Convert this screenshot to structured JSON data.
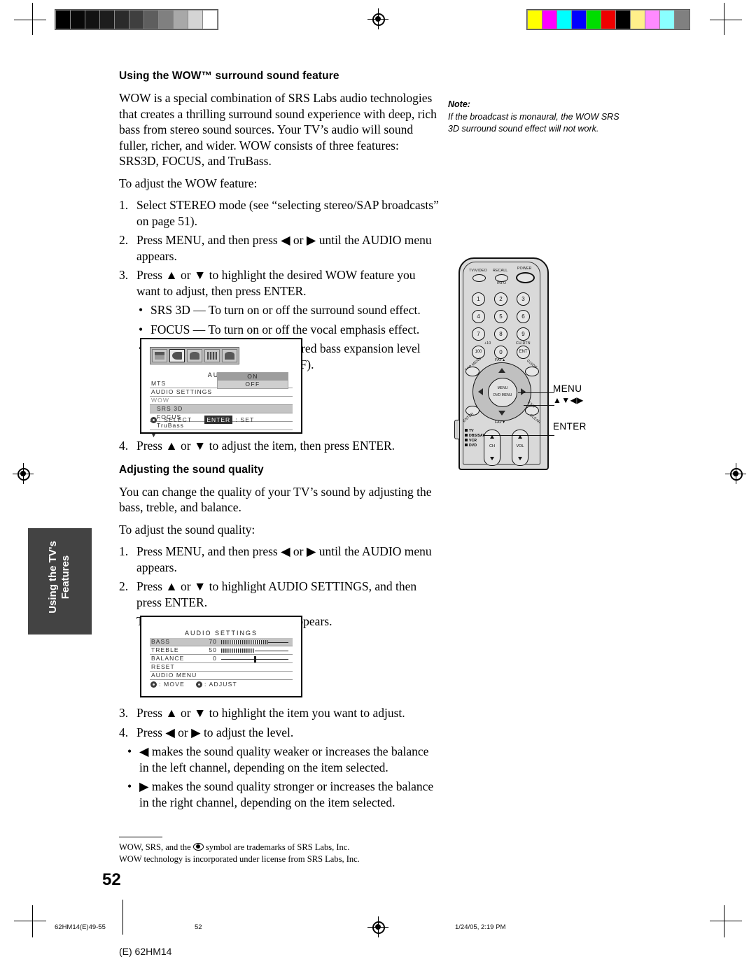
{
  "page": {
    "number": "52",
    "side_tab": "Using the TV's Features"
  },
  "section1": {
    "heading": "Using the WOW™ surround sound feature",
    "intro": "WOW is a special combination of SRS Labs audio technologies that creates a thrilling surround sound experience with deep, rich bass from stereo sound sources. Your TV’s audio will sound fuller, richer, and wider. WOW consists of three features: SRS3D, FOCUS, and TruBass.",
    "lead": "To adjust the WOW feature:",
    "steps": [
      {
        "num": "1.",
        "text": "Select STEREO mode (see “selecting stereo/SAP broadcasts” on page 51)."
      },
      {
        "num": "2.",
        "text": "Press MENU, and then press ◀ or ▶ until the AUDIO menu appears."
      },
      {
        "num": "3.",
        "text": "Press ▲ or ▼ to highlight the desired WOW feature you want to adjust, then press ENTER."
      }
    ],
    "bullets": [
      {
        "bullet": "•",
        "text": "SRS 3D — To turn on or off the surround sound effect."
      },
      {
        "bullet": "•",
        "text": "FOCUS — To turn on or off the vocal emphasis effect."
      },
      {
        "bullet": "•",
        "text": "TruBass — To select your desired bass expansion level (HIGH, LOW or OFF)."
      }
    ],
    "step4": {
      "num": "4.",
      "text": "Press ▲ or ▼ to adjust the item, then press ENTER."
    }
  },
  "note": {
    "label": "Note:",
    "text": "If the broadcast is monaural, the WOW SRS 3D surround sound effect will not work."
  },
  "osd_audio": {
    "title": "AUDIO",
    "rows": [
      {
        "label": "MTS",
        "state": "normal"
      },
      {
        "label": "AUDIO SETTINGS",
        "state": "normal"
      },
      {
        "label": "WOW",
        "state": "dim"
      },
      {
        "label": "SRS 3D",
        "state": "highlight"
      },
      {
        "label": "FOCUS",
        "state": "indent"
      },
      {
        "label": "TruBass",
        "state": "indent"
      }
    ],
    "scroll_arrow": "▼",
    "options": [
      {
        "label": "ON",
        "selected": true
      },
      {
        "label": "OFF",
        "selected": false
      }
    ],
    "footer_select": ": SELECT",
    "footer_enter_key": "ENTER",
    "footer_enter_action": ": SET",
    "tab_icons": [
      "picture-icon",
      "audio-icon",
      "antenna-icon",
      "setup-icon",
      "lock-icon"
    ],
    "selected_tab_index": 1
  },
  "section2": {
    "heading": "Adjusting the sound quality",
    "intro": "You can change the quality of your TV’s sound by adjusting the bass, treble, and balance.",
    "lead": "To adjust the sound quality:",
    "steps": [
      {
        "num": "1.",
        "text": "Press MENU, and then press ◀ or ▶ until the AUDIO menu appears."
      },
      {
        "num": "2.",
        "text": "Press ▲ or ▼ to highlight AUDIO SETTINGS, and then press ENTER."
      }
    ],
    "after_step2": "The AUDIO SETTINGS menu appears.",
    "steps_b": [
      {
        "num": "3.",
        "text": "Press ▲ or ▼ to highlight the item you want to adjust."
      },
      {
        "num": "4.",
        "text": "Press ◀ or ▶ to adjust the level."
      }
    ],
    "bullets": [
      {
        "bullet": "•",
        "text": "◀ makes the sound quality weaker or increases the balance in the left channel, depending on the item selected."
      },
      {
        "bullet": "•",
        "text": "▶ makes the sound quality stronger or increases the balance in the right channel, depending on the item selected."
      }
    ]
  },
  "osd_settings": {
    "title": "AUDIO SETTINGS",
    "rows": [
      {
        "label": "BASS",
        "value": "70",
        "bar": "fill",
        "pct": 70,
        "state": "highlight"
      },
      {
        "label": "TREBLE",
        "value": "50",
        "bar": "fill",
        "pct": 50,
        "state": "normal"
      },
      {
        "label": "BALANCE",
        "value": "0",
        "bar": "center",
        "pct": 50,
        "state": "normal"
      },
      {
        "label": "RESET",
        "value": "",
        "bar": "none",
        "pct": 0,
        "state": "normal"
      },
      {
        "label": "AUDIO MENU",
        "value": "",
        "bar": "none",
        "pct": 0,
        "state": "normal"
      }
    ],
    "footer_move": ": MOVE",
    "footer_adjust": ": ADJUST"
  },
  "remote": {
    "buttons": {
      "tv_video": "TV/VIDEO",
      "recall": "RECALL",
      "info": "INFO",
      "power": "POWER",
      "keys": [
        "1",
        "2",
        "3",
        "4",
        "5",
        "6",
        "7",
        "8",
        "9",
        "100",
        "0",
        "ENT"
      ],
      "plus10": "+10",
      "chrtn": "CH RTN",
      "fav_up": "FAV▲",
      "fav_down": "FAV▼",
      "menu_line1": "MENU",
      "menu_line2": "DVD MENU",
      "enter": "ENTER",
      "exit": "EXIT",
      "clear": "CLEAR",
      "guide": "GUIDE",
      "pic_size": "PIC SIZE",
      "favorite": "FAVORITE",
      "top_menu": "TOP MENU",
      "ch": "CH",
      "vol": "VOL"
    },
    "modes": [
      "TV",
      "DBS/SAT",
      "VCR",
      "DVD"
    ],
    "callouts": [
      "MENU",
      "▲▼◀▶",
      "ENTER"
    ]
  },
  "footnote": {
    "line1_a": "WOW, SRS, and the ",
    "line1_b": " symbol are trademarks of SRS Labs, Inc.",
    "line2": "WOW technology is incorporated under license from SRS Labs, Inc."
  },
  "print_footer": {
    "left": "62HM14(E)49-55",
    "center": "52",
    "right": "1/24/05, 2:19 PM",
    "bottom": "(E) 62HM14"
  },
  "colors": {
    "grayscale": [
      "#000000",
      "#080808",
      "#121212",
      "#1d1d1d",
      "#2b2b2b",
      "#3f3f3f",
      "#5e5e5e",
      "#808080",
      "#a8a8a8",
      "#d4d4d4",
      "#ffffff"
    ],
    "colorbar": [
      "#ffff00",
      "#ff00ff",
      "#00ffff",
      "#0000ff",
      "#00dd00",
      "#ee0000",
      "#000000",
      "#ffef8a",
      "#ff8aff",
      "#8affff",
      "#808080"
    ],
    "tab_bg": "#434343"
  }
}
